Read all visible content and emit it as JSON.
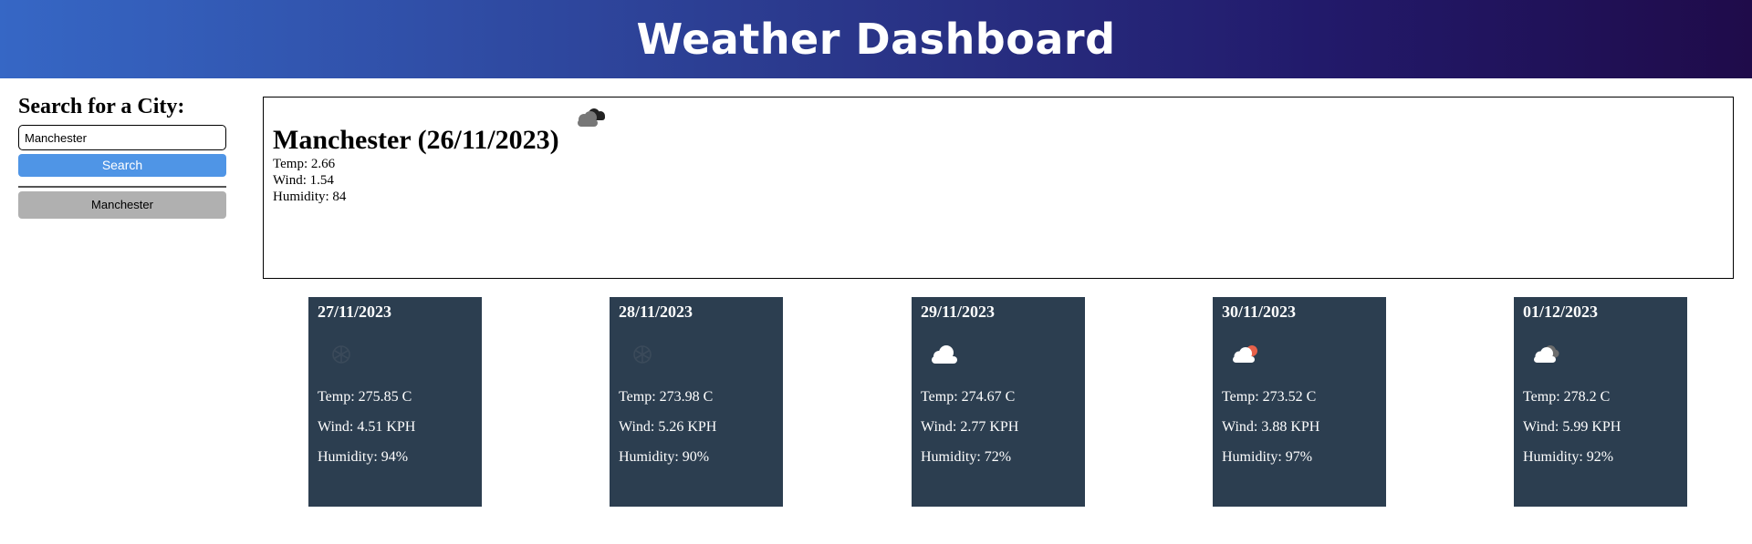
{
  "header": {
    "title": "Weather Dashboard"
  },
  "sidebar": {
    "heading": "Search for a City:",
    "search_value": "Manchester",
    "search_button_label": "Search",
    "history": [
      {
        "label": "Manchester"
      }
    ]
  },
  "current": {
    "title": "Manchester (26/11/2023)",
    "icon": "cloudy-dark-icon",
    "temp": "Temp: 2.66",
    "wind": "Wind: 1.54",
    "humidity": "Humidity: 84"
  },
  "forecast": [
    {
      "date": "27/11/2023",
      "icon": "snow-icon",
      "temp": "Temp: 275.85 C",
      "wind": "Wind: 4.51 KPH",
      "humidity": "Humidity: 94%"
    },
    {
      "date": "28/11/2023",
      "icon": "snow-icon",
      "temp": "Temp: 273.98 C",
      "wind": "Wind: 5.26 KPH",
      "humidity": "Humidity: 90%"
    },
    {
      "date": "29/11/2023",
      "icon": "cloud-icon",
      "temp": "Temp: 274.67 C",
      "wind": "Wind: 2.77 KPH",
      "humidity": "Humidity: 72%"
    },
    {
      "date": "30/11/2023",
      "icon": "cloud-sun-icon",
      "temp": "Temp: 273.52 C",
      "wind": "Wind: 3.88 KPH",
      "humidity": "Humidity: 97%"
    },
    {
      "date": "01/12/2023",
      "icon": "broken-clouds-icon",
      "temp": "Temp: 278.2 C",
      "wind": "Wind: 5.99 KPH",
      "humidity": "Humidity: 92%"
    }
  ],
  "colors": {
    "card_bg": "#2c3e50",
    "search_button": "#4f95e6",
    "history_button": "#b0b0b0"
  }
}
